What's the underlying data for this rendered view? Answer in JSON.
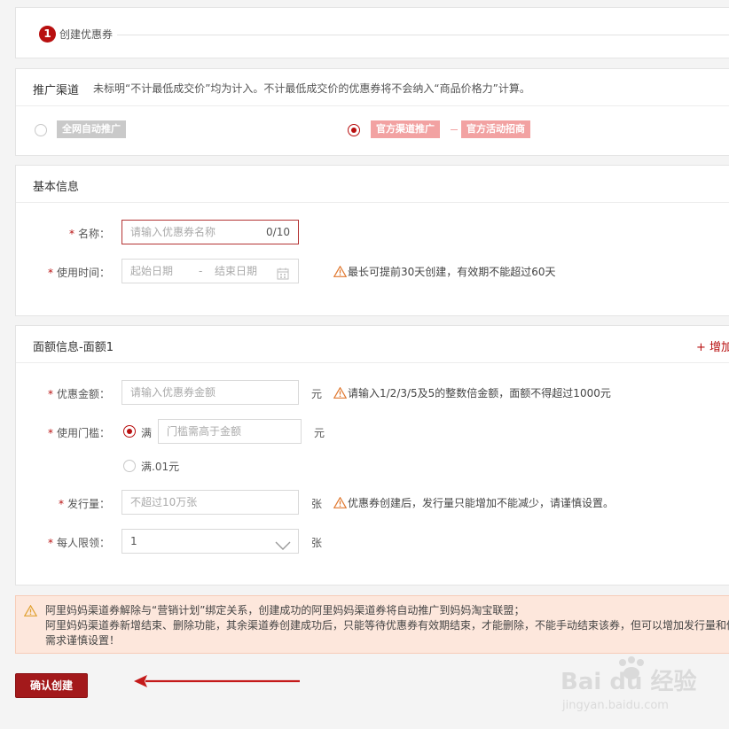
{
  "step": {
    "number": "1",
    "label": "创建优惠券"
  },
  "channel": {
    "title": "推广渠道",
    "note": "未标明“不计最低成交价”均为计入。不计最低成交价的优惠券将不会纳入“商品价格力”计算。",
    "options": [
      {
        "tags": [
          "全网自动推广"
        ],
        "selected": false
      },
      {
        "tags": [
          "官方渠道推广",
          "官方活动招商"
        ],
        "selected": true
      }
    ]
  },
  "basic": {
    "title": "基本信息",
    "name_label": "名称：",
    "name_placeholder": "请输入优惠券名称",
    "name_counter": "0/10",
    "time_label": "使用时间：",
    "start_placeholder": "起始日期",
    "date_sep": "-",
    "end_placeholder": "结束日期",
    "time_hint": "最长可提前30天创建，有效期不能超过60天"
  },
  "amount": {
    "title": "面额信息-面额1",
    "add_label": "+ 增加",
    "value_label": "优惠金额：",
    "value_placeholder": "请输入优惠券金额",
    "unit_yuan": "元",
    "value_hint": "请输入1/2/3/5及5的整数倍金额，面额不得超过1000元",
    "threshold_label": "使用门槛：",
    "threshold_opt1": "满",
    "threshold_placeholder": "门槛需高于金额",
    "threshold_opt2": "满.01元",
    "issue_label": "发行量：",
    "issue_placeholder": "不超过10万张",
    "unit_zhang": "张",
    "issue_hint": "优惠券创建后，发行量只能增加不能减少，请谨慎设置。",
    "limit_label": "每人限领：",
    "limit_value": "1"
  },
  "notice": {
    "lines": [
      "阿里妈妈渠道券解除与“营销计划”绑定关系，创建成功的阿里妈妈渠道券将自动推广到妈妈淘宝联盟；",
      "阿里妈妈渠道券新增结束、删除功能，其余渠道券创建成功后，只能等待优惠券有效期结束，才能删除，不能手动结束该券，但可以增加发行量和修",
      "需求谨慎设置！"
    ]
  },
  "confirm_label": "确认创建",
  "watermark": {
    "brand": "Bai du 经验",
    "url": "jingyan.baidu.com"
  },
  "colors": {
    "accent": "#b80f0f",
    "button": "#a3191b",
    "tag_pink": "#f2a2a2",
    "tag_grey": "#c9c9c9",
    "notice_bg": "#fde7dc",
    "warn": "#e0782f"
  }
}
